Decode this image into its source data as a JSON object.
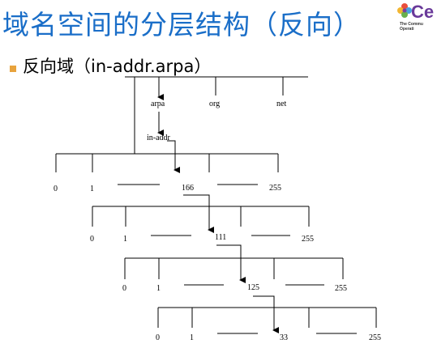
{
  "title": "域名空间的分层结构（反向）",
  "logo": {
    "text": "Ce",
    "subtitle": "The Commu\nOperati"
  },
  "bullet": "反向域（in-addr.arpa）",
  "top_labels": [
    "arpa",
    "org",
    "net",
    "in-addr"
  ],
  "levels": [
    {
      "values": [
        "0",
        "1",
        "166",
        "255"
      ]
    },
    {
      "values": [
        "0",
        "1",
        "111",
        "255"
      ]
    },
    {
      "values": [
        "0",
        "1",
        "125",
        "255"
      ]
    },
    {
      "values": [
        "0",
        "1",
        "33",
        "255"
      ]
    }
  ],
  "colors": {
    "title": "#1a6ec8",
    "bullet": "#e8a33d",
    "line": "#000000"
  }
}
